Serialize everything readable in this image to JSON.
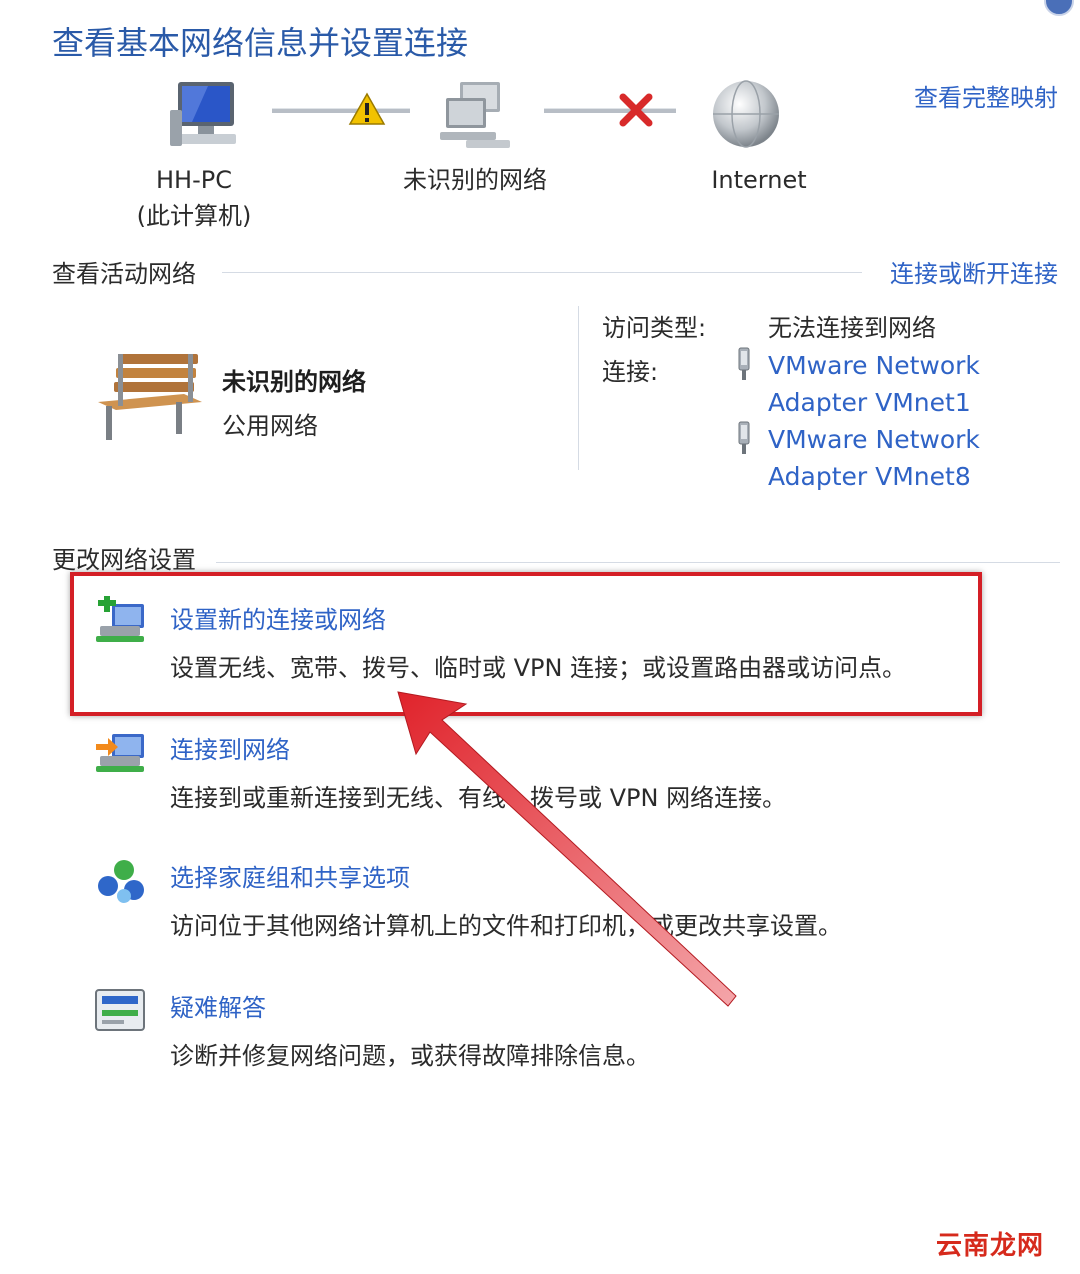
{
  "header": {
    "title": "查看基本网络信息并设置连接",
    "full_map_link": "查看完整映射"
  },
  "network_map": {
    "nodes": [
      {
        "label": "HH-PC",
        "sublabel": "(此计算机)",
        "icon": "computer-icon"
      },
      {
        "label": "未识别的网络",
        "icon": "network-icon"
      },
      {
        "label": "Internet",
        "icon": "globe-icon"
      }
    ],
    "links": [
      {
        "status": "warning",
        "icon": "warning-icon",
        "color": "#f2c200"
      },
      {
        "status": "disconnected",
        "icon": "red-x-icon",
        "color": "#d82a2a"
      }
    ]
  },
  "active_networks": {
    "section_title": "查看活动网络",
    "connect_link": "连接或断开连接",
    "network_name": "未识别的网络",
    "network_type": "公用网络",
    "network_icon": "park-bench-icon",
    "access_type_label": "访问类型:",
    "access_type_value": "无法连接到网络",
    "connections_label": "连接:",
    "adapters": [
      {
        "line1": "VMware Network",
        "line2": "Adapter VMnet1",
        "icon": "network-adapter-icon"
      },
      {
        "line1": "VMware Network",
        "line2": "Adapter VMnet8",
        "icon": "network-adapter-icon"
      }
    ]
  },
  "change_settings": {
    "section_title": "更改网络设置",
    "tasks": [
      {
        "title": "设置新的连接或网络",
        "desc": "设置无线、宽带、拨号、临时或 VPN 连接；或设置路由器或访问点。",
        "icon": "new-connection-icon"
      },
      {
        "title": "连接到网络",
        "desc": "连接到或重新连接到无线、有线、拨号或 VPN 网络连接。",
        "icon": "connect-network-icon"
      },
      {
        "title": "选择家庭组和共享选项",
        "desc": "访问位于其他网络计算机上的文件和打印机，或更改共享设置。",
        "icon": "homegroup-icon"
      },
      {
        "title": "疑难解答",
        "desc": "诊断并修复网络问题，或获得故障排除信息。",
        "icon": "troubleshoot-icon"
      }
    ]
  },
  "annotation": {
    "highlight_color": "#d41f26",
    "arrow_color": "#d41f26"
  },
  "watermark": "云南龙网",
  "colors": {
    "link": "#2f63c6",
    "title": "#2a5aa8",
    "text": "#2b2b2b"
  }
}
